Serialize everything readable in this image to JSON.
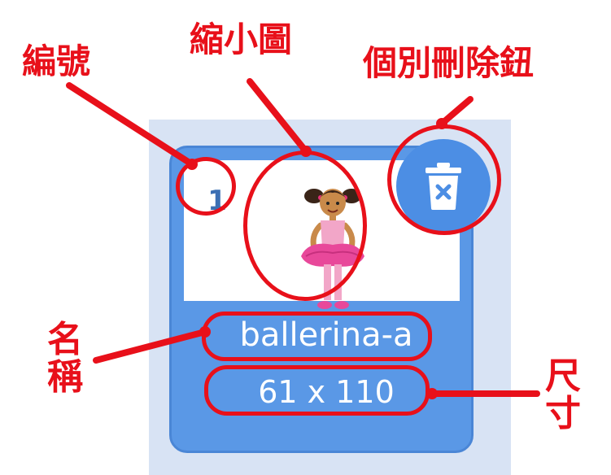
{
  "costume": {
    "number": "1",
    "name": "ballerina-a",
    "size": "61 x 110"
  },
  "annotations": {
    "number_label": "編號",
    "thumbnail_label": "縮小圖",
    "delete_label": "個別刪除鈕",
    "name_label": "名稱",
    "size_label": "尺寸"
  },
  "icons": {
    "delete": "trash-can-icon",
    "thumbnail": "ballerina-costume"
  },
  "colors": {
    "tile": "#5a98e6",
    "panel": "#d8e3f4",
    "annotation": "#e8101a",
    "number": "#3c6fb4"
  }
}
